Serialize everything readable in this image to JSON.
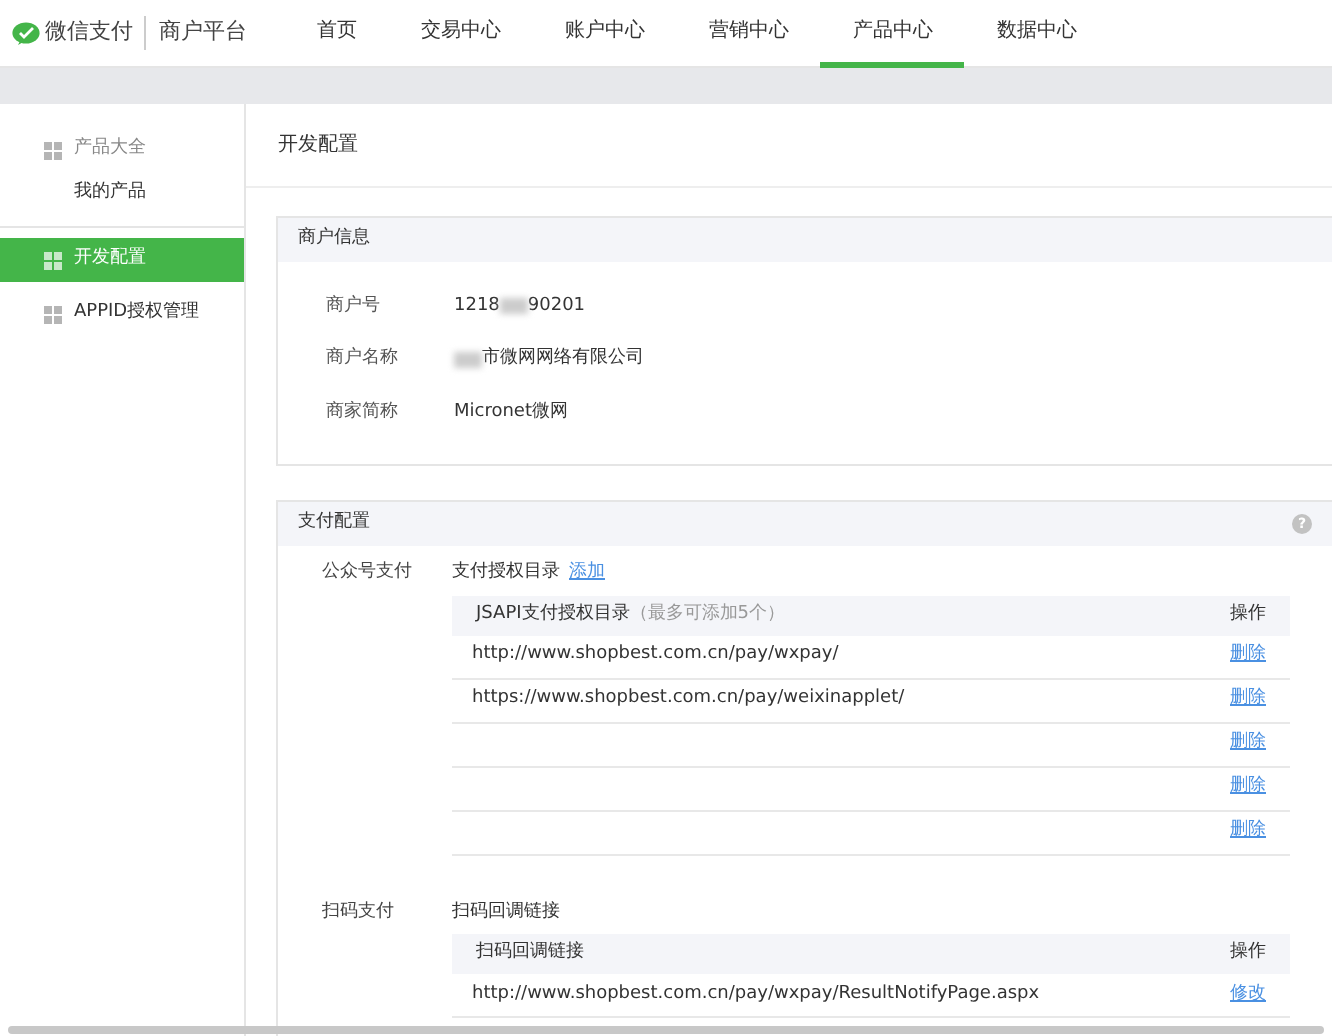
{
  "brand": {
    "name": "微信支付",
    "platform": "商户平台"
  },
  "nav": [
    {
      "label": "首页",
      "selected": false
    },
    {
      "label": "交易中心",
      "selected": false
    },
    {
      "label": "账户中心",
      "selected": false
    },
    {
      "label": "营销中心",
      "selected": false
    },
    {
      "label": "产品中心",
      "selected": true
    },
    {
      "label": "数据中心",
      "selected": false
    }
  ],
  "sidebar": [
    {
      "label": "产品大全",
      "selected": false,
      "children": [
        {
          "label": "我的产品",
          "selected": false
        }
      ]
    },
    {
      "label": "开发配置",
      "selected": true
    },
    {
      "label": "APPID授权管理",
      "selected": false
    }
  ],
  "page_title": "开发配置",
  "merchant_info": {
    "title": "商户信息",
    "fields": [
      {
        "label": "商户号",
        "prefix": "1218",
        "suffix": "90201",
        "blurred": true
      },
      {
        "label": "商户名称",
        "suffix": "市微网网络有限公司",
        "blurred": true
      },
      {
        "label": "商家简称",
        "suffix": "Micronet微网",
        "blurred": false
      }
    ]
  },
  "pay_config": {
    "title": "支付配置",
    "help": "?",
    "sections": [
      {
        "label": "公众号支付",
        "subtitle": "支付授权目录",
        "link": "添加",
        "table": {
          "columns": [
            "JSAPI支付授权目录",
            "（最多可添加5个）",
            "操作"
          ],
          "rows": [
            {
              "url": "http://www.shopbest.com.cn/pay/wxpay/",
              "action": "删除"
            },
            {
              "url": "https://www.shopbest.com.cn/pay/weixinapplet/",
              "action": "删除"
            },
            {
              "url": "",
              "action": "删除"
            },
            {
              "url": "",
              "action": "删除"
            },
            {
              "url": "",
              "action": "删除"
            }
          ]
        }
      },
      {
        "label": "扫码支付",
        "subtitle": "扫码回调链接",
        "table": {
          "columns": [
            "扫码回调链接",
            "",
            "操作"
          ],
          "rows": [
            {
              "url": "http://www.shopbest.com.cn/pay/wxpay/ResultNotifyPage.aspx",
              "action": "修改"
            }
          ]
        }
      }
    ]
  }
}
